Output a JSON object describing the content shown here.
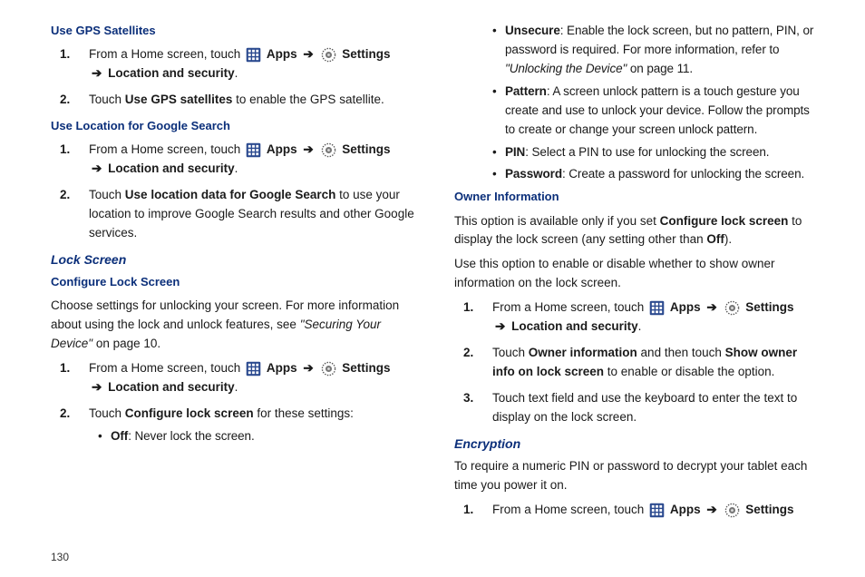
{
  "pageNumber": "130",
  "left": {
    "h1": "Use GPS Satellites",
    "s1_1a": "From a Home screen, touch",
    "apps": "Apps",
    "settings": "Settings",
    "locSec": "Location and security",
    "touch": "Touch",
    "s1_2b": "Use GPS satellites",
    "s1_2c": " to enable the GPS satellite.",
    "h2": "Use Location for Google Search",
    "s2_2b": "Use location data for Google Search",
    "s2_2c": " to use your location to improve Google Search results and other Google services.",
    "h3": "Lock Screen",
    "h4": "Configure Lock Screen",
    "p1a": "Choose settings for unlocking your screen. For more information about using the lock and unlock features, see ",
    "p1b": "\"Securing Your Device\"",
    "p1c": " on page 10.",
    "s3_2b": "Configure lock screen",
    "s3_2c": " for these settings:",
    "b1a": "Off",
    "b1b": ": Never lock the screen."
  },
  "right": {
    "b2a": "Unsecure",
    "b2b": ": Enable the lock screen, but no pattern, PIN, or password is required. For more information, refer to ",
    "b2c": "\"Unlocking the Device\"",
    "b2d": "  on page 11.",
    "b3a": "Pattern",
    "b3b": ": A screen unlock pattern is a touch gesture you create and use to unlock your device. Follow the prompts to create or change your screen unlock pattern.",
    "b4a": "PIN",
    "b4b": ": Select a PIN to use for unlocking the screen.",
    "b5a": "Password",
    "b5b": ": Create a password for unlocking the screen.",
    "h5": "Owner Information",
    "p2a": "This option is available only if you set ",
    "p2b": "Configure lock screen",
    "p2c": " to display the lock screen (any setting other than ",
    "p2d": "Off",
    "p2e": ").",
    "p3": "Use this option to enable or disable whether to show owner information on the lock screen.",
    "s4_2a": "Touch ",
    "s4_2b": "Owner information",
    "s4_2c": " and then touch ",
    "s4_2d": "Show owner info on lock screen",
    "s4_2e": " to enable or disable the option.",
    "s4_3": "Touch text field and use the keyboard to enter the text to display on the lock screen.",
    "h6": "Encryption",
    "p4": "To require a numeric PIN or password to decrypt your tablet each time you power it on."
  },
  "arrow": "➔"
}
